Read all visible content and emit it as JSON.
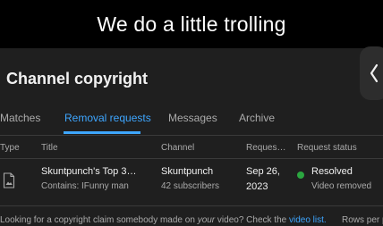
{
  "meme": {
    "caption": "We do a little trolling"
  },
  "page": {
    "title": "Channel copyright",
    "back_icon": "chevron-left-icon"
  },
  "tabs": [
    {
      "label": "Matches",
      "active": false
    },
    {
      "label": "Removal requests",
      "active": true
    },
    {
      "label": "Messages",
      "active": false
    },
    {
      "label": "Archive",
      "active": false
    }
  ],
  "table": {
    "columns": [
      "Type",
      "Title",
      "Channel",
      "Reques…",
      "Request status"
    ],
    "rows": [
      {
        "type_icon": "document-image-icon",
        "title": "Skuntpunch's Top 3…",
        "contains": "Contains: IFunny man",
        "channel": "Skuntpunch",
        "subscribers": "42 subscribers",
        "date_line1": "Sep 26,",
        "date_line2": "2023",
        "status": "Resolved",
        "status_detail": "Video removed",
        "status_color": "#2ba640"
      }
    ]
  },
  "footer": {
    "text_before": "Looking for a copyright claim somebody made on ",
    "text_emph": "your",
    "text_after": " video? Check the ",
    "link": "video list.",
    "rows_per_page": "Rows per p"
  },
  "colors": {
    "background": "#1f1f1f",
    "accent": "#3ea6ff",
    "text_primary": "#f1f1f1",
    "text_secondary": "#aaaaaa",
    "success": "#2ba640"
  }
}
